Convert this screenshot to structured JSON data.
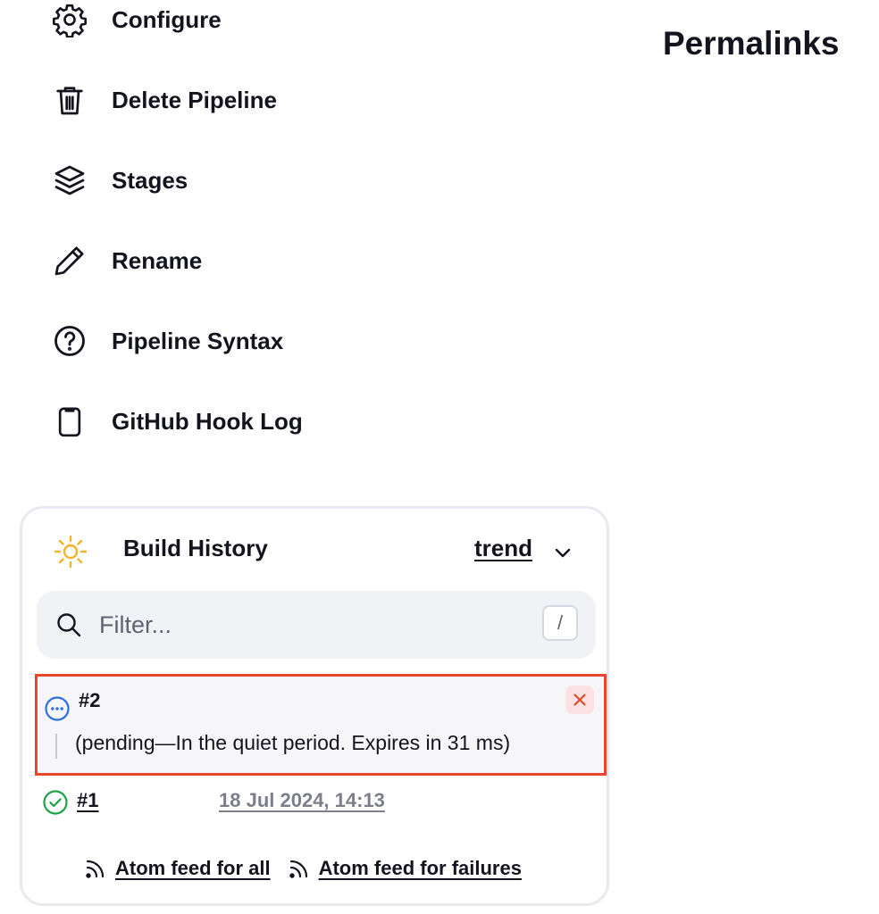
{
  "side_nav": {
    "items": [
      {
        "label": "Configure",
        "icon": "gear-icon"
      },
      {
        "label": "Delete Pipeline",
        "icon": "trash-icon"
      },
      {
        "label": "Stages",
        "icon": "layers-icon"
      },
      {
        "label": "Rename",
        "icon": "pencil-icon"
      },
      {
        "label": "Pipeline Syntax",
        "icon": "help-circle-icon"
      },
      {
        "label": "GitHub Hook Log",
        "icon": "clipboard-icon"
      }
    ]
  },
  "permalinks": {
    "title": "Permalinks"
  },
  "build_history": {
    "title": "Build History",
    "trend_label": "trend",
    "filter_placeholder": "Filter...",
    "filter_shortcut": "/",
    "builds": [
      {
        "number": "#2",
        "status": "pending",
        "status_text": "(pending—In the quiet period. Expires in 31 ms)"
      },
      {
        "number": "#1",
        "status": "success",
        "date": "18 Jul 2024, 14:13"
      }
    ],
    "feeds": {
      "all_label": "Atom feed for all",
      "failures_label": "Atom feed for failures"
    }
  },
  "colors": {
    "text": "#14141f",
    "muted": "#60636f",
    "sun": "#f6b12a",
    "pending": "#2d6fe0",
    "success": "#1ea446",
    "danger": "#e5482d",
    "cancel_bg": "#fbe1e1"
  }
}
